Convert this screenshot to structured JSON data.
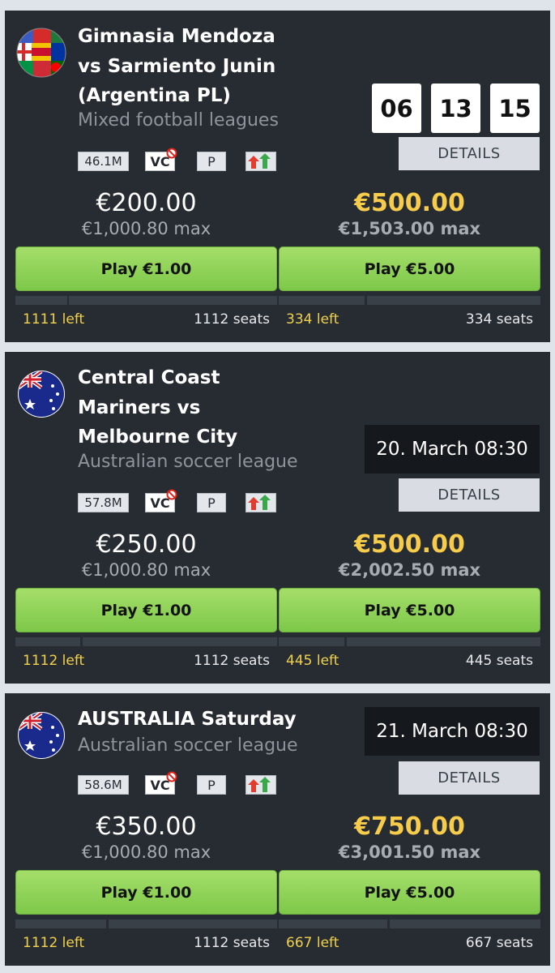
{
  "common": {
    "details_label": "DETAILS",
    "badge_vc": "VC",
    "badge_p": "P",
    "badge_trend": "trend-up-down-icon"
  },
  "events": [
    {
      "title": "Gimnasia Mendoza vs Sarmiento Junin (Argentina PL)",
      "league": "Mixed football leagues",
      "logo": "world-flags-ball-icon",
      "size_badge": "46.1M",
      "countdown": [
        "06",
        "13",
        "15"
      ],
      "left_prize": "€200.00",
      "left_max": "€1,000.80 max",
      "right_prize": "€500.00",
      "right_max": "€1,503.00 max",
      "play_left": "Play €1.00",
      "play_right": "Play €5.00",
      "left_remaining": "1111 left",
      "left_seats": "1112 seats",
      "right_remaining": "334 left",
      "right_seats": "334 seats"
    },
    {
      "title": "Central Coast Mariners vs Melbourne City",
      "league": "Australian soccer league",
      "logo": "australia-flag-icon",
      "size_badge": "57.8M",
      "date": "20. March 08:30",
      "left_prize": "€250.00",
      "left_max": "€1,000.80 max",
      "right_prize": "€500.00",
      "right_max": "€2,002.50 max",
      "play_left": "Play €1.00",
      "play_right": "Play €5.00",
      "left_remaining": "1112 left",
      "left_seats": "1112 seats",
      "right_remaining": "445 left",
      "right_seats": "445 seats"
    },
    {
      "title": "AUSTRALIA Saturday",
      "league": "Australian soccer league",
      "logo": "australia-flag-icon",
      "size_badge": "58.6M",
      "date": "21. March 08:30",
      "left_prize": "€350.00",
      "left_max": "€1,000.80 max",
      "right_prize": "€750.00",
      "right_max": "€3,001.50 max",
      "play_left": "Play €1.00",
      "play_right": "Play €5.00",
      "left_remaining": "1112 left",
      "left_seats": "1112 seats",
      "right_remaining": "667 left",
      "right_seats": "667 seats"
    }
  ],
  "colors": {
    "card_bg": "#272c33",
    "page_bg": "#dfe3ea",
    "accent_gold": "#f7cc4a",
    "play_green": "#8fd357",
    "details_bg": "#d9dde3"
  }
}
